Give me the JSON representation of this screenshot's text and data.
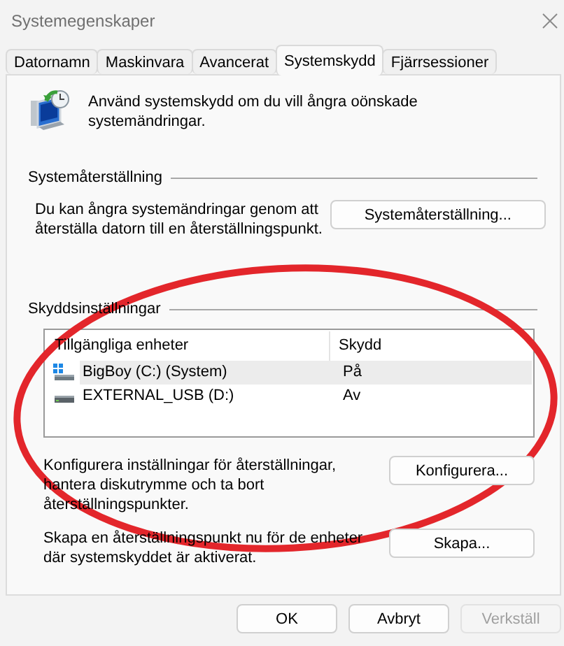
{
  "window": {
    "title": "Systemegenskaper"
  },
  "tabs": [
    {
      "label": "Datornamn",
      "selected": false
    },
    {
      "label": "Maskinvara",
      "selected": false
    },
    {
      "label": "Avancerat",
      "selected": false
    },
    {
      "label": "Systemskydd",
      "selected": true
    },
    {
      "label": "Fjärrsessioner",
      "selected": false
    }
  ],
  "intro": {
    "text": "Använd systemskydd om du vill ångra oönskade systemändringar."
  },
  "restore_section": {
    "title": "Systemåterställning",
    "description": "Du kan ångra systemändringar genom att återställa datorn till en återställningspunkt.",
    "button": "Systemåterställning..."
  },
  "protection_section": {
    "title": "Skyddsinställningar",
    "columns": [
      "Tillgängliga enheter",
      "Skydd"
    ],
    "drives": [
      {
        "name": "BigBoy (C:) (System)",
        "protection": "På",
        "kind": "system",
        "selected": true
      },
      {
        "name": "EXTERNAL_USB (D:)",
        "protection": "Av",
        "kind": "external",
        "selected": false
      }
    ],
    "configure": {
      "description": "Konfigurera inställningar för återställningar, hantera diskutrymme och ta bort återställningspunkter.",
      "button": "Konfigurera..."
    },
    "create": {
      "description": "Skapa en återställningspunkt nu för de enheter där systemskyddet är aktiverat.",
      "button": "Skapa..."
    }
  },
  "buttons": [
    {
      "label": "OK",
      "disabled": false
    },
    {
      "label": "Avbryt",
      "disabled": false
    },
    {
      "label": "Verkställ",
      "disabled": true
    }
  ],
  "annotation": {
    "kind": "ellipse"
  }
}
